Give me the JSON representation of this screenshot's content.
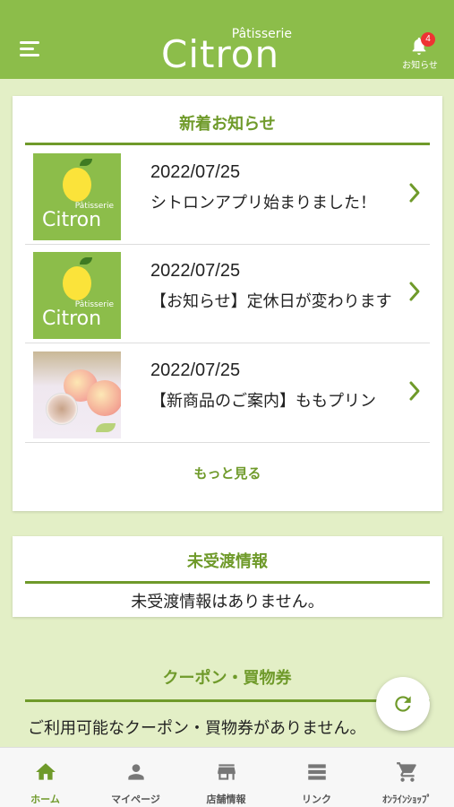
{
  "colors": {
    "brand_green": "#8cbd4a",
    "accent_green": "#6f9a2a",
    "background": "#e3efc6",
    "badge_red": "#e33333"
  },
  "header": {
    "menu_icon": "hamburger-icon",
    "logo_small": "Pâtisserie",
    "logo_big": "Citron",
    "notification": {
      "icon": "bell-icon",
      "count": "4",
      "label": "お知らせ"
    }
  },
  "news": {
    "title": "新着お知らせ",
    "items": [
      {
        "date": "2022/07/25",
        "text": "シトロンアプリ始まりました！",
        "thumb_small": "Pâtisserie",
        "thumb_big": "Citron"
      },
      {
        "date": "2022/07/25",
        "text": "【お知らせ】定休日が変わります",
        "thumb_small": "Pâtisserie",
        "thumb_big": "Citron"
      },
      {
        "date": "2022/07/25",
        "text": "【新商品のご案内】ももプリン"
      }
    ],
    "more_label": "もっと見る"
  },
  "undelivered": {
    "title": "未受渡情報",
    "message": "未受渡情報はありません。"
  },
  "coupon": {
    "title": "クーポン・買物券",
    "message": "ご利用可能なクーポン・買物券がありません。"
  },
  "refresh_icon": "refresh-icon",
  "tabs": [
    {
      "label": "ホーム",
      "icon": "home-icon",
      "active": true
    },
    {
      "label": "マイページ",
      "icon": "person-icon"
    },
    {
      "label": "店舗情報",
      "icon": "store-icon"
    },
    {
      "label": "リンク",
      "icon": "list-icon"
    },
    {
      "label": "ｵﾝﾗｲﾝｼｮｯﾌﾟ",
      "icon": "cart-icon"
    }
  ]
}
